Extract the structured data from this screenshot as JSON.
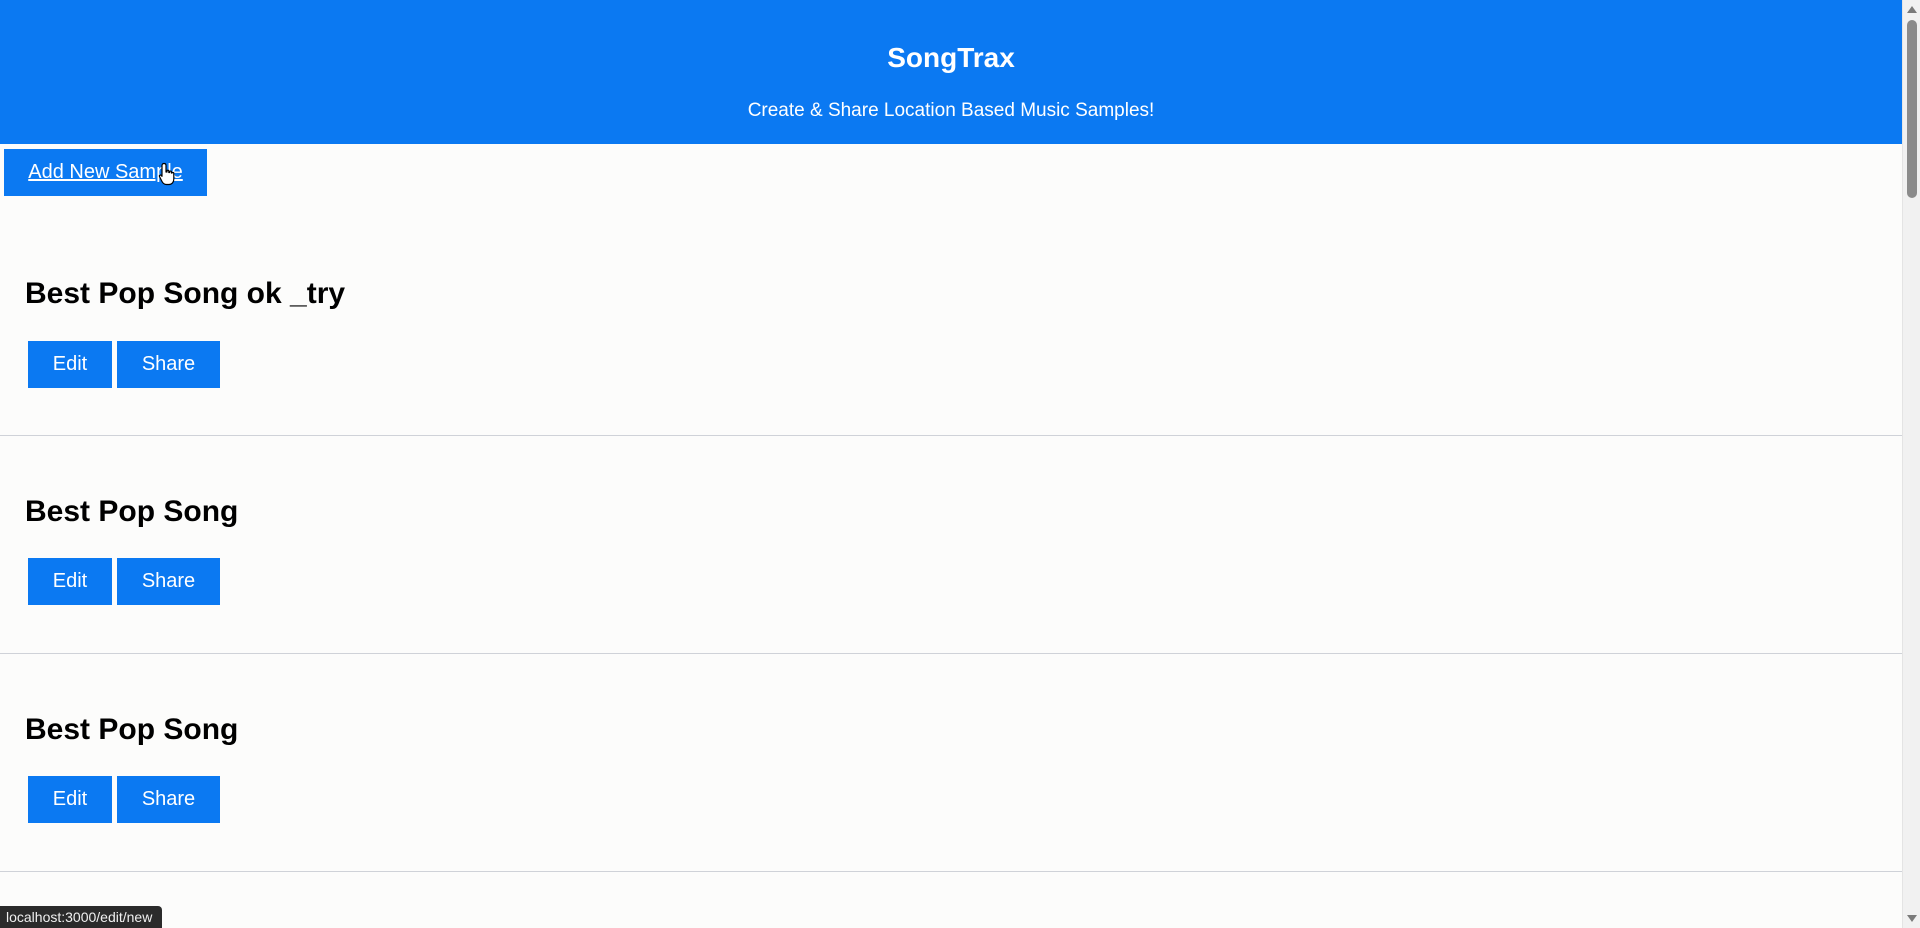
{
  "header": {
    "title": "SongTrax",
    "subtitle": "Create & Share Location Based Music Samples!"
  },
  "toolbar": {
    "add_label": "Add New Sample"
  },
  "samples": [
    {
      "title": "Best Pop Song ok _try",
      "edit_label": "Edit",
      "share_label": "Share"
    },
    {
      "title": "Best Pop Song",
      "edit_label": "Edit",
      "share_label": "Share"
    },
    {
      "title": "Best Pop Song",
      "edit_label": "Edit",
      "share_label": "Share"
    }
  ],
  "status_bar": {
    "url": "localhost:3000/edit/new"
  },
  "colors": {
    "primary": "#0b79f2",
    "background": "#fcfcfb",
    "divider": "#cfd2d8"
  }
}
